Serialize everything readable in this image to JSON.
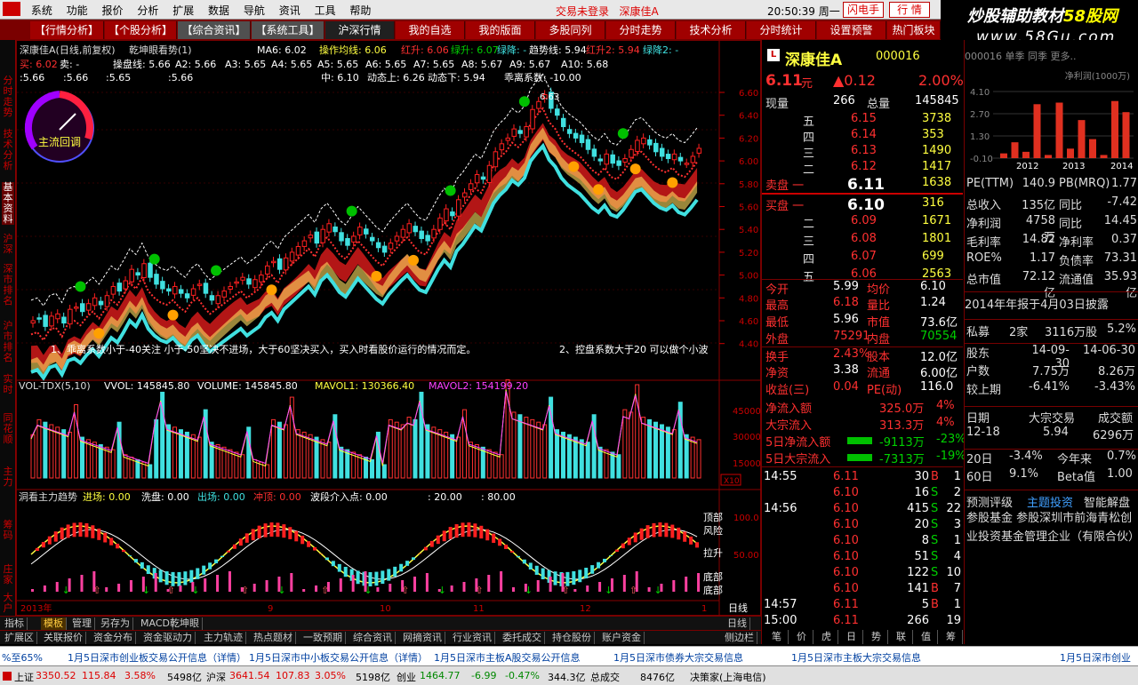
{
  "menu": [
    "系统",
    "功能",
    "报价",
    "分析",
    "扩展",
    "数据",
    "导航",
    "资讯",
    "工具",
    "帮助"
  ],
  "status": {
    "login": "交易未登录",
    "stock_name": "深康佳A",
    "time": "20:50:39 周一",
    "flash_btn": "闪电手",
    "quote_btn": "行 情"
  },
  "tabs": [
    "【行情分析】",
    "【个股分析】",
    "【综合资讯】",
    "【系统工具】",
    "沪深行情",
    "我的自选",
    "我的版面",
    "多股同列",
    "分时走势",
    "技术分析",
    "分时统计",
    "设置预警",
    "热门板块"
  ],
  "watermark": {
    "line1": "炒股辅助教材",
    "line1b": "58股网",
    "line2": "www.58Gu.com"
  },
  "leftnav": [
    "分时走势",
    "技术分析",
    "基本资料",
    "沪深",
    "深市排名",
    "沪市排名",
    "实时",
    "同花顺",
    "主力",
    "筹码",
    "庄家",
    "大户",
    "指标",
    "钱"
  ],
  "chart": {
    "title": "深康佳A(日线,前复权)",
    "indicator": "乾坤眼看势(1)",
    "ma6": "MA6: 6.02",
    "ops": "操作均线: 6.06",
    "redup": "红升: 6.06",
    "greenup": "绿升: 6.07",
    "greendown": "绿降: -",
    "trend": "趋势线: 5.94",
    "redup2": "红升2: 5.94",
    "greendown2": "绿降2: -",
    "row2": [
      "买: 6.02",
      "卖: -",
      "操盘线: 5.66",
      "A2: 5.66",
      "A3: 5.65",
      "A4: 5.65",
      "A5: 5.65",
      "A6: 5.65",
      "A7: 5.65",
      "A8: 5.67",
      "A9: 5.67",
      "A10: 5.68"
    ],
    "row3": [
      ":5.66",
      ":5.66",
      ":5.65",
      ":5.66"
    ],
    "row4": [
      "中: 6.10",
      "动态上: 6.26",
      "动态下: 5.94",
      "乖离系数: -10.00"
    ],
    "gauge_label": "主流回调",
    "note1": "1、乖离系数小于-40关注 小于-50坚决不进场，大于60坚决买入，买入时看股价运行的情况而定。",
    "note2": "2、控盘系数大于20 可以做个小波",
    "yticks": [
      "6.60",
      "6.40",
      "6.20",
      "6.00",
      "5.80",
      "5.60",
      "5.40",
      "5.20",
      "5.00",
      "4.80",
      "4.60",
      "4.40"
    ],
    "peak": "6.63",
    "vol_title": "VOL-TDX(5,10)",
    "vvol": "VVOL: 145845.80",
    "volume": "VOLUME: 145845.80",
    "mavol1": "MAVOL1: 130366.40",
    "mavol2": "MAVOL2: 154199.20",
    "vol_ticks": [
      "45000",
      "30000",
      "15000"
    ],
    "vol_unit": "X10",
    "ind3_title": "洞看主力趋势",
    "ind3": [
      "进场: 0.00",
      "洗盘: 0.00",
      "出场: 0.00",
      "冲顶: 0.00",
      "波段介入点: 0.00",
      ": 20.00",
      ": 80.00"
    ],
    "ind3_ticks": [
      "100.0",
      "50.00"
    ],
    "ind3_labels": [
      "顶部",
      "风险",
      "拉升",
      "底部",
      "底部"
    ],
    "xlabels": [
      "2013年",
      "9",
      "10",
      "11",
      "12",
      "1"
    ],
    "cycle": "日线"
  },
  "bottom_tabs": [
    "指标",
    "模板",
    "管理",
    "另存为",
    "MACD",
    "乾坤眼"
  ],
  "bottom_tabs2": [
    "扩展区",
    "关联报价",
    "资金分布",
    "资金驱动力",
    "主力轨迹",
    "热点题材",
    "一致预期",
    "综合资讯",
    "网摘资讯",
    "行业资讯",
    "委托成交",
    "持仓股份",
    "账户资金"
  ],
  "bottom_right": [
    "日线",
    "+",
    "-",
    "侧边栏"
  ],
  "quote": {
    "name": "深康佳A",
    "code": "000016",
    "price": "6.11",
    "unit": "元",
    "chg": "▲0.12",
    "pct": "2.00%",
    "now_label": "现量",
    "now": "266",
    "total_label": "总量",
    "total": "145845",
    "sell": [
      {
        "l": "五",
        "p": "6.15",
        "v": "3738"
      },
      {
        "l": "四",
        "p": "6.14",
        "v": "353"
      },
      {
        "l": "三",
        "p": "6.13",
        "v": "1490"
      },
      {
        "l": "二",
        "p": "6.12",
        "v": "1417"
      },
      {
        "l": "卖盘 一",
        "p": "6.11",
        "v": "1638"
      }
    ],
    "buy": [
      {
        "l": "买盘 一",
        "p": "6.10",
        "v": "316"
      },
      {
        "l": "二",
        "p": "6.09",
        "v": "1671"
      },
      {
        "l": "三",
        "p": "6.08",
        "v": "1801"
      },
      {
        "l": "四",
        "p": "6.07",
        "v": "699"
      },
      {
        "l": "五",
        "p": "6.06",
        "v": "2563"
      }
    ],
    "stats": [
      [
        "今开",
        "5.99",
        "均价",
        "6.10"
      ],
      [
        "最高",
        "6.18",
        "量比",
        "1.24"
      ],
      [
        "最低",
        "5.96",
        "市值",
        "73.6亿"
      ],
      [
        "外盘",
        "75291",
        "内盘",
        "70554"
      ],
      [
        "换手",
        "2.43%",
        "股本",
        "12.0亿"
      ],
      [
        "净资",
        "3.38",
        "流通",
        "6.00亿"
      ],
      [
        "收益(三)",
        "0.04",
        "PE(动)",
        "116.0"
      ]
    ],
    "flow": [
      [
        "净流入额",
        "325.0万",
        "4%"
      ],
      [
        "大宗流入",
        "313.3万",
        "4%"
      ],
      [
        "5日净流入额",
        "-9113万",
        "-23%"
      ],
      [
        "5日大宗流入",
        "-7313万",
        "-19%"
      ]
    ],
    "ticks": [
      [
        "14:55",
        "6.11",
        "30",
        "B",
        "1"
      ],
      [
        "",
        "6.10",
        "16",
        "S",
        "2"
      ],
      [
        "14:56",
        "6.10",
        "415",
        "S",
        "22"
      ],
      [
        "",
        "6.10",
        "20",
        "S",
        "3"
      ],
      [
        "",
        "6.10",
        "8",
        "S",
        "1"
      ],
      [
        "",
        "6.10",
        "51",
        "S",
        "4"
      ],
      [
        "",
        "6.10",
        "122",
        "S",
        "10"
      ],
      [
        "",
        "6.10",
        "141",
        "B",
        "7"
      ],
      [
        "14:57",
        "6.11",
        "5",
        "B",
        "1"
      ],
      [
        "15:00",
        "6.11",
        "266",
        "",
        "19"
      ]
    ],
    "bottom_tabs": [
      "笔",
      "价",
      "虎",
      "日",
      "势",
      "联",
      "值",
      "筹"
    ]
  },
  "f10": {
    "header": "000016 单季 同季 更多..",
    "chart_title": "净利润(1000万)",
    "yticks": [
      "4.10",
      "2.70",
      "1.30",
      "-0.10"
    ],
    "years": [
      "2012",
      "2013",
      "2014"
    ],
    "bars": [
      0.3,
      1.0,
      0.4,
      3.4,
      0.2,
      3.5,
      0.6,
      2.4,
      1.2,
      0.2,
      3.6,
      2.9
    ],
    "rows": [
      [
        "PE(TTM)",
        "140.9",
        "PB(MRQ)",
        "1.77"
      ],
      [
        "总收入",
        "135亿",
        "同比",
        "-7.42"
      ],
      [
        "净利润",
        "4758万",
        "同比",
        "14.45"
      ],
      [
        "毛利率",
        "14.82",
        "净利率",
        "0.37"
      ],
      [
        "ROE%",
        "1.17",
        "负债率",
        "73.31"
      ],
      [
        "总市值",
        "72.12亿",
        "流通值",
        "35.93亿"
      ]
    ],
    "report": "2014年年报于4月03日披露",
    "private": [
      "私募",
      "2家",
      "3116万股",
      "5.2%"
    ],
    "holders": [
      [
        "股东",
        "14-09-30",
        "14-06-30"
      ],
      [
        "户数",
        "7.75万",
        "8.26万"
      ],
      [
        "较上期",
        "-6.41%",
        "-3.43%"
      ]
    ],
    "deal_head": [
      "日期",
      "大宗交易",
      "成交额"
    ],
    "deal": [
      "12-18",
      "5.94",
      "6296万"
    ],
    "perf": [
      [
        "20日",
        "-3.4%",
        "今年来",
        "0.7%"
      ],
      [
        "60日",
        "9.1%",
        "Beta值",
        "1.00"
      ]
    ],
    "links": [
      "预测评级",
      "主题投资",
      "智能解盘"
    ],
    "fund": "参股基金 参股深圳市前海青松创业投资基金管理企业（有限合伙）"
  },
  "news": [
    "%至65%",
    "1月5日深市创业板交易公开信息（详情）",
    "1月5日深市中小板交易公开信息（详情）",
    "1月5日深市主板A股交易公开信息",
    "1月5日深市债券大宗交易信息",
    "1月5日深市主板大宗交易信息",
    "1月5日深市创业"
  ],
  "statusbar": {
    "sh": "上证",
    "sh_v": "3350.52",
    "sh_c": "115.84",
    "sh_p": "3.58%",
    "sh_a": "5498亿",
    "sz": "沪深",
    "sz_v": "3641.54",
    "sz_c": "107.83",
    "sz_p": "3.05%",
    "sz_a": "5198亿",
    "cy": "创业",
    "cy_v": "1464.77",
    "cy_c": "-6.99",
    "cy_p": "-0.47%",
    "cy_a": "344.3亿",
    "total": "总成交",
    "total_v": "8476亿",
    "bottom": "决策家(上海电信)"
  }
}
